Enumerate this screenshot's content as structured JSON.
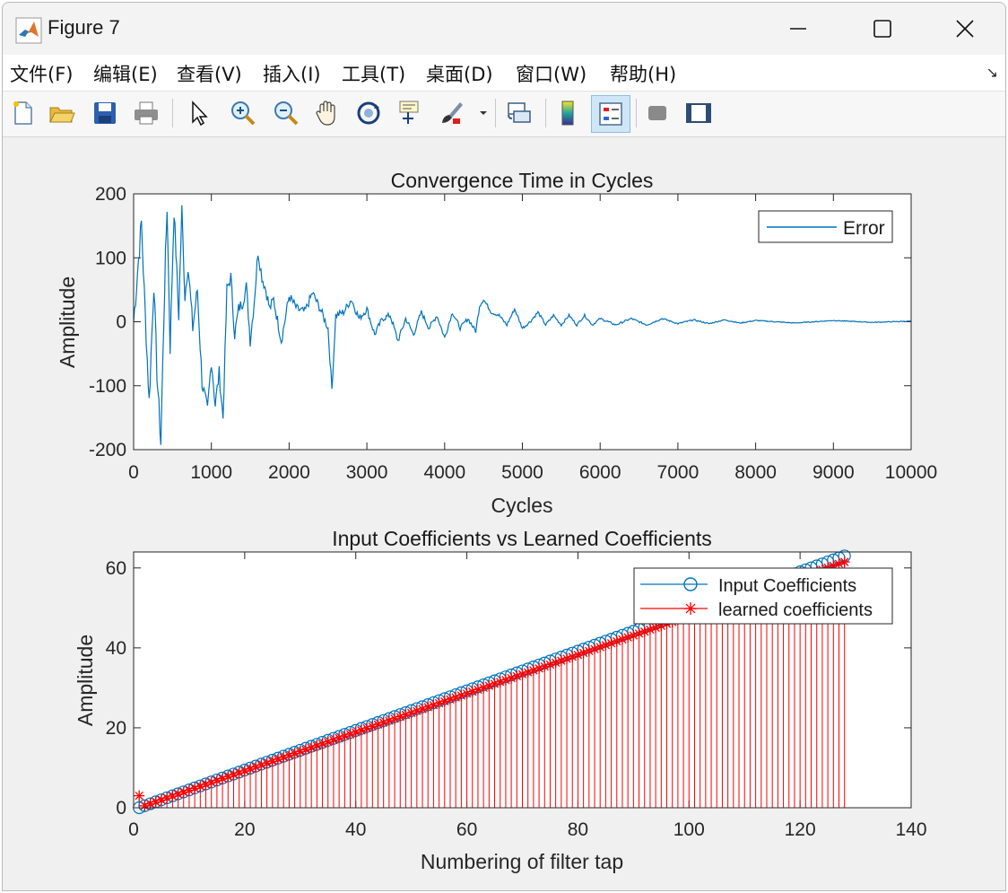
{
  "window": {
    "title": "Figure 7",
    "controls": [
      "minimize-icon",
      "maximize-icon",
      "close-icon"
    ]
  },
  "menubar": {
    "items": [
      {
        "label": "文件(F)"
      },
      {
        "label": "编辑(E)"
      },
      {
        "label": "查看(V)"
      },
      {
        "label": "插入(I)"
      },
      {
        "label": "工具(T)"
      },
      {
        "label": "桌面(D)"
      },
      {
        "label": "窗口(W)"
      },
      {
        "label": "帮助(H)"
      }
    ],
    "overflow_arrow": "↘"
  },
  "toolbar": {
    "buttons": [
      "new-figure-icon",
      "open-file-icon",
      "save-icon",
      "print-icon",
      "select-arrow-icon",
      "zoom-in-icon",
      "zoom-out-icon",
      "pan-hand-icon",
      "rotate-3d-icon",
      "data-cursor-icon",
      "brush-icon",
      "link-plot-icon",
      "colorbar-icon",
      "legend-icon",
      "hide-plot-tools-icon",
      "show-plot-tools-icon"
    ],
    "pressed": "legend-icon"
  },
  "colors": {
    "error_line": "#0072BD",
    "input_coeff": "#0072BD",
    "learned_coeff": "#FF0000"
  },
  "chart_data": [
    {
      "type": "line",
      "title": "Convergence Time in Cycles",
      "xlabel": "Cycles",
      "ylabel": "Amplitude",
      "xlim": [
        0,
        10000
      ],
      "ylim": [
        -200,
        200
      ],
      "xticks": [
        "0",
        "1000",
        "2000",
        "3000",
        "4000",
        "5000",
        "6000",
        "7000",
        "8000",
        "9000",
        "10000"
      ],
      "yticks": [
        "200",
        "100",
        "0",
        "-100",
        "-200"
      ],
      "legend": {
        "position": "top-right",
        "entries": [
          "Error"
        ]
      },
      "grid": false,
      "series": [
        {
          "name": "Error",
          "x": [
            0,
            100,
            150,
            200,
            260,
            300,
            350,
            400,
            430,
            470,
            520,
            580,
            620,
            660,
            700,
            760,
            820,
            880,
            950,
            1000,
            1050,
            1100,
            1150,
            1200,
            1250,
            1300,
            1350,
            1400,
            1450,
            1500,
            1550,
            1600,
            1650,
            1700,
            1750,
            1800,
            1900,
            2000,
            2100,
            2200,
            2300,
            2400,
            2500,
            2550,
            2600,
            2700,
            2800,
            2900,
            3000,
            3100,
            3200,
            3300,
            3400,
            3500,
            3600,
            3700,
            3800,
            3900,
            4000,
            4100,
            4200,
            4300,
            4400,
            4450,
            4500,
            4600,
            4700,
            4800,
            4900,
            5000,
            5100,
            5200,
            5300,
            5400,
            5500,
            5600,
            5700,
            5800,
            5900,
            6000,
            6200,
            6400,
            6600,
            6800,
            7000,
            7200,
            7400,
            7600,
            7800,
            8000,
            8500,
            9000,
            9500,
            10000
          ],
          "y": [
            0,
            155,
            10,
            -125,
            60,
            -80,
            -190,
            60,
            180,
            -40,
            175,
            10,
            175,
            40,
            90,
            -10,
            50,
            -95,
            -140,
            -60,
            -130,
            -80,
            -150,
            50,
            70,
            -20,
            20,
            30,
            55,
            -30,
            30,
            110,
            70,
            50,
            20,
            35,
            -30,
            40,
            20,
            15,
            45,
            20,
            -10,
            -105,
            10,
            15,
            35,
            5,
            20,
            -20,
            5,
            10,
            -30,
            5,
            -20,
            15,
            -10,
            10,
            -25,
            15,
            -10,
            5,
            -15,
            25,
            35,
            15,
            10,
            -5,
            20,
            -10,
            0,
            15,
            -5,
            10,
            -5,
            10,
            -5,
            10,
            -5,
            5,
            -5,
            5,
            -5,
            5,
            -3,
            3,
            -3,
            3,
            -2,
            2,
            -2,
            2,
            -1,
            1
          ]
        }
      ]
    },
    {
      "type": "stem",
      "title": "Input Coefficients vs Learned Coefficients",
      "xlabel": "Numbering of filter tap",
      "ylabel": "Amplitude",
      "xlim": [
        0,
        140
      ],
      "ylim": [
        0,
        64
      ],
      "xticks": [
        "0",
        "20",
        "40",
        "60",
        "80",
        "100",
        "120",
        "140"
      ],
      "yticks": [
        "60",
        "40",
        "20",
        "0"
      ],
      "legend": {
        "position": "top-right",
        "entries": [
          "Input Coefficients",
          "learned coefficients"
        ]
      },
      "grid": false,
      "series": [
        {
          "name": "Input Coefficients",
          "marker": "circle",
          "x_start": 1,
          "x_end": 128,
          "y_start": 0,
          "y_end": 63
        },
        {
          "name": "learned coefficients",
          "marker": "star",
          "x_start": 1,
          "x_end": 128,
          "y_start": 0,
          "y_end": 61.5,
          "first_point": [
            1,
            3
          ]
        }
      ]
    }
  ]
}
